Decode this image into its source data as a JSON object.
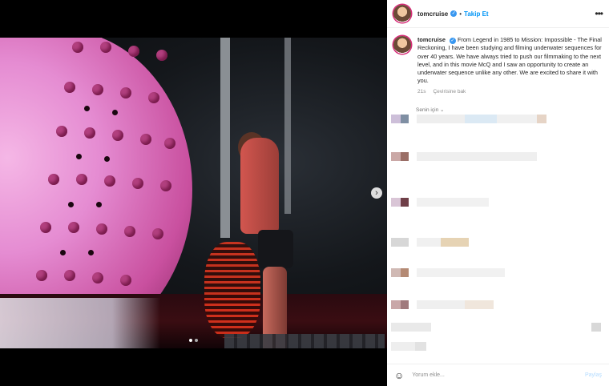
{
  "post": {
    "username": "tomcruise",
    "separator": "•",
    "follow_label": "Takip Et",
    "more_label": "•••",
    "caption_text": "From Legend in 1985 to Mission: Impossible - The Final Reckoning, I have been studying and filming underwater sequences for over 40 years. We have always tried to push our filmmaking to the next level, and in this movie McQ and I saw an opportunity to create an underwater sequence unlike any other. We are excited to share it with you.",
    "time_ago": "21s",
    "translate_label": "Çevirisine bak",
    "for_you_label": "Senin için",
    "for_you_chevron": "chevron-down-icon"
  },
  "media": {
    "next_icon": "chevron-right-icon",
    "next_label": "›",
    "slide_count": 2,
    "active_slide": 1
  },
  "footer": {
    "emoji_icon": "smiley-icon",
    "emoji_label": "☺",
    "comment_placeholder": "Yorum ekle...",
    "post_label": "Paylaş"
  },
  "colors": {
    "accent": "#0095f6",
    "verified": "#3897f0",
    "text": "#262626",
    "muted": "#8e8e8e"
  }
}
